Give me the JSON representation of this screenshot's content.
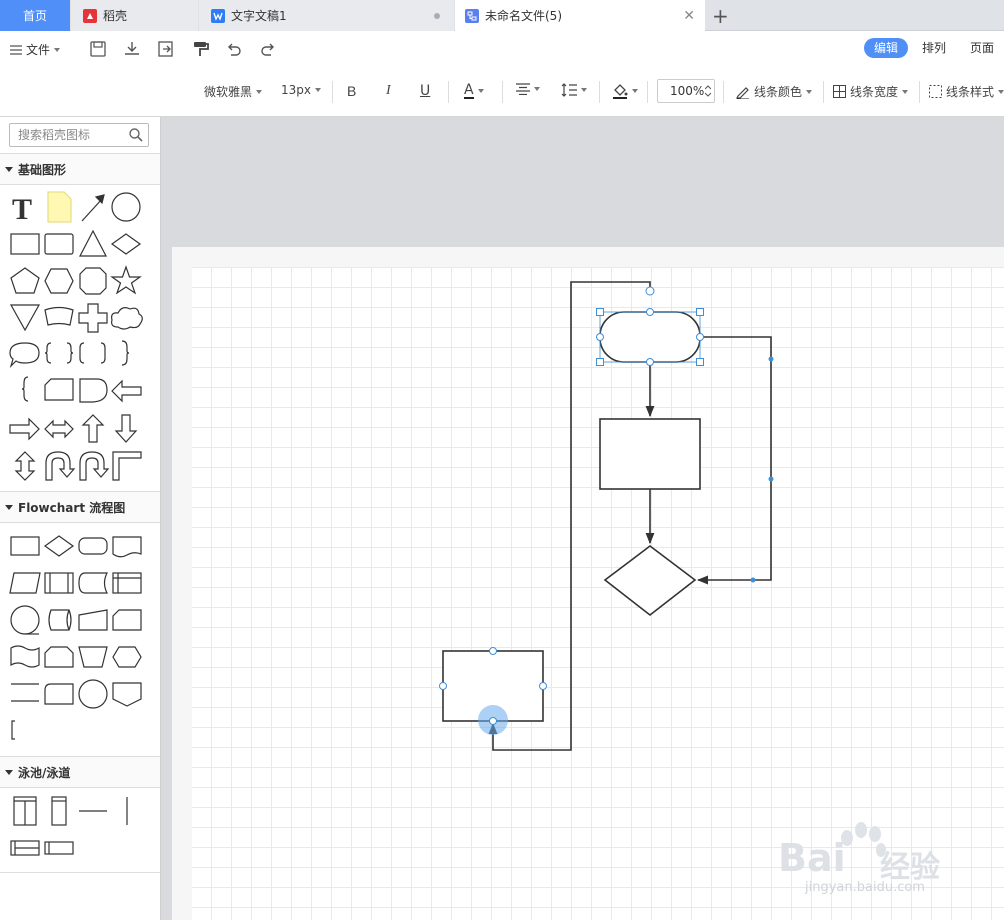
{
  "tabs": {
    "home": "首页",
    "docer": "稻壳",
    "doc": "文字文稿1",
    "current": "未命名文件(5)",
    "add": "+"
  },
  "menubar": {
    "file": "文件",
    "edit": "编辑",
    "arrange": "排列",
    "page": "页面"
  },
  "toolbar": {
    "font": "微软雅黑",
    "size": "13px",
    "bold": "B",
    "italic": "I",
    "underline": "U",
    "font_color": "A",
    "zoom": "100%",
    "line_color": "线条颜色",
    "line_width": "线条宽度",
    "line_style": "线条样式"
  },
  "sidebar": {
    "search_placeholder": "搜索稻壳图标",
    "sections": {
      "basic": "基础图形",
      "flowchart": "Flowchart 流程图",
      "swimlane": "泳池/泳道"
    }
  },
  "watermark": {
    "brand": "Bai",
    "brand_cn": "经验",
    "url": "jingyan.baidu.com"
  },
  "colors": {
    "accent": "#4f8ff7",
    "selection": "#3d8fd8"
  }
}
